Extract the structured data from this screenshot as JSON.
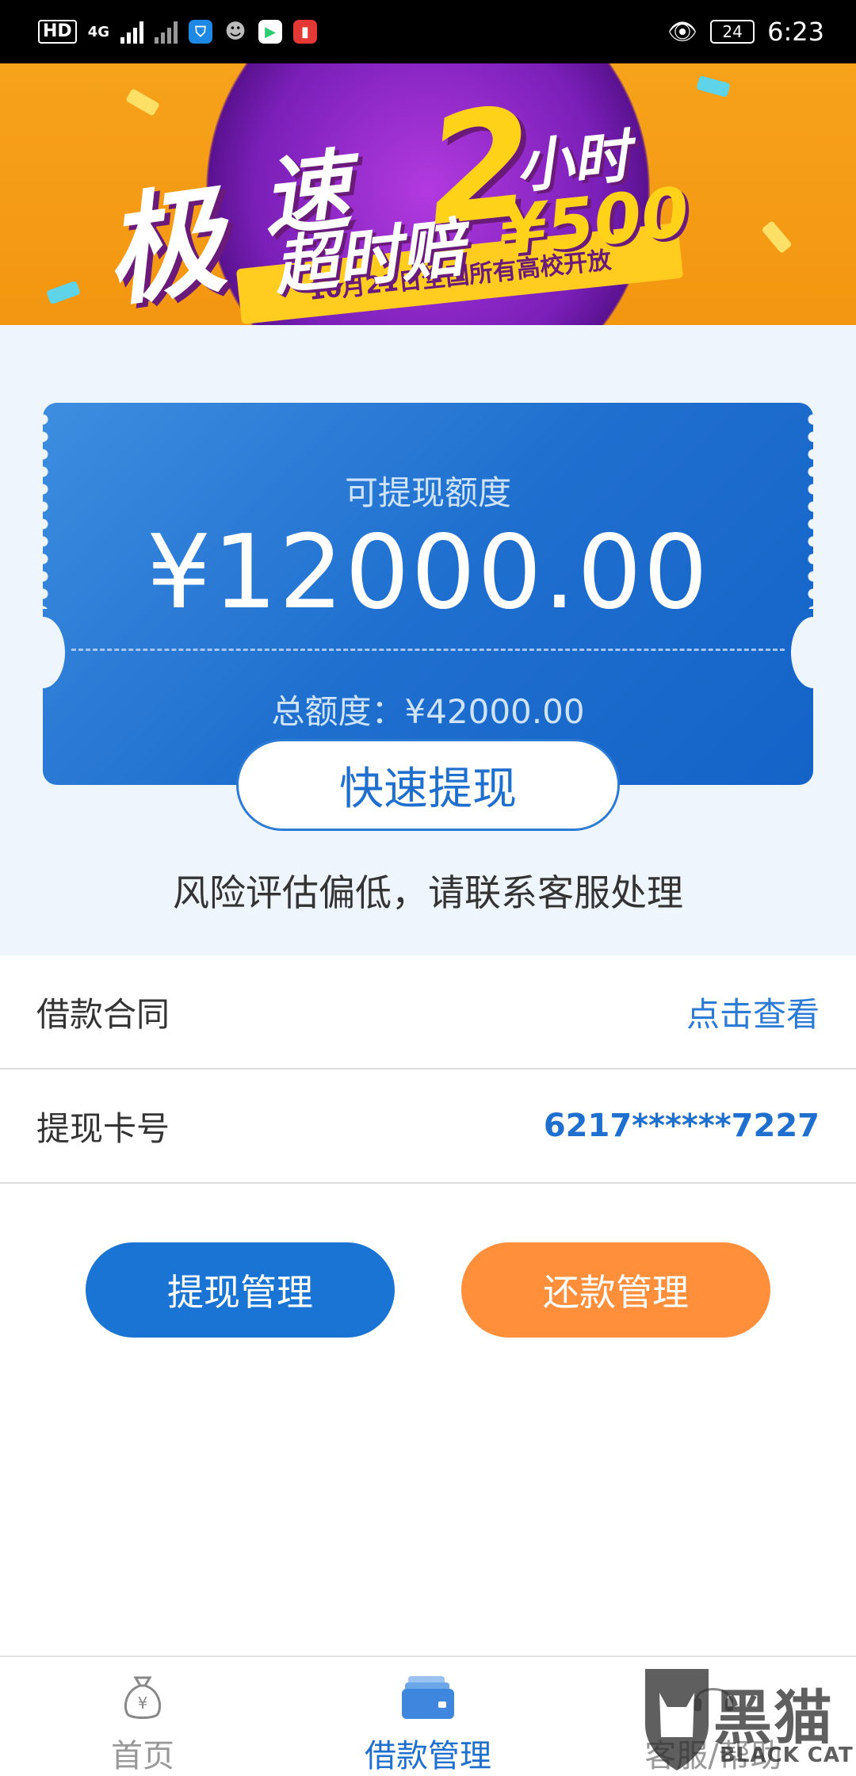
{
  "status_bar": {
    "hd": "HD",
    "network": "4G",
    "battery": "24",
    "time": "6:23"
  },
  "banner": {
    "title_1": "极",
    "title_2": "速",
    "number": "2",
    "title_hours": "小时",
    "title_compensate": "超时赔",
    "prize": "¥500",
    "ribbon": "10月21日全国所有高校开放"
  },
  "quota": {
    "label": "可提现额度",
    "amount": "¥12000.00",
    "total": "总额度：¥42000.00"
  },
  "withdraw_button": "快速提现",
  "risk_note": "风险评估偏低，请联系客服处理",
  "rows": {
    "contract": {
      "label": "借款合同",
      "value": "点击查看"
    },
    "card": {
      "label": "提现卡号",
      "value": "6217******7227"
    }
  },
  "actions": {
    "withdraw_manage": "提现管理",
    "repay_manage": "还款管理"
  },
  "bottom_nav": {
    "home": "首页",
    "loan": "借款管理",
    "service": "客服/帮助"
  },
  "watermark": {
    "text": "黑猫",
    "sub": "BLACK CAT"
  },
  "colors": {
    "primary_blue": "#1f6fcf",
    "orange": "#ff8f3a",
    "section_bg": "#eef5fc"
  }
}
